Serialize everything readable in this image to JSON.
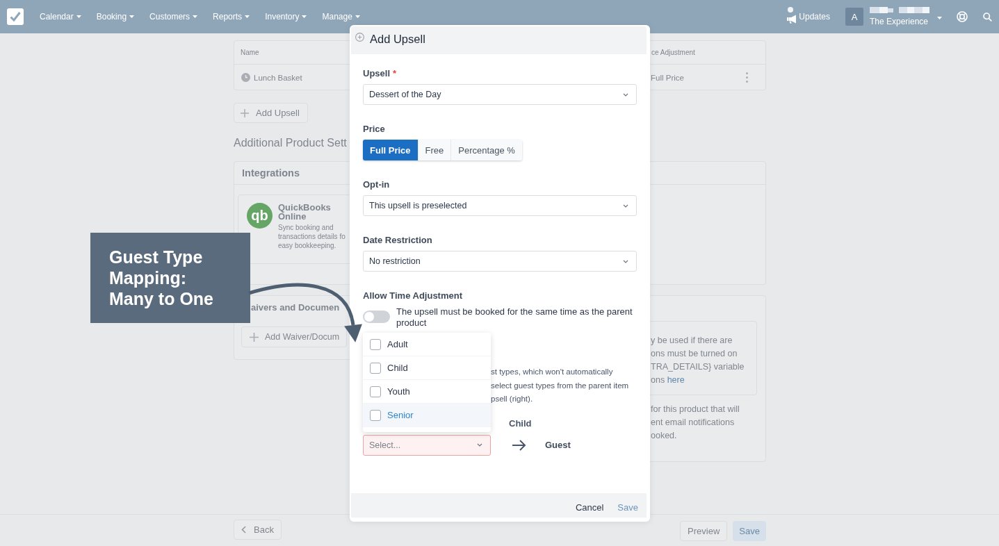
{
  "nav": {
    "items": [
      {
        "label": "Calendar"
      },
      {
        "label": "Booking"
      },
      {
        "label": "Customers"
      },
      {
        "label": "Reports"
      },
      {
        "label": "Inventory"
      },
      {
        "label": "Manage"
      }
    ],
    "updates": "Updates",
    "account": {
      "initial": "A",
      "name": "The Experience"
    }
  },
  "upsells_table": {
    "columns": [
      "Name",
      "ce Adjustment"
    ],
    "rows": [
      {
        "cells": [
          "Lunch Basket",
          "Full Price"
        ]
      }
    ]
  },
  "add_upsell_button": "Add Upsell",
  "section_title": "Additional Product Sett",
  "integrations": {
    "title": "Integrations",
    "items": [
      {
        "logo": "qb",
        "name": "QuickBooks Online",
        "description": [
          "Sync booking and",
          "transactions details fo",
          "easy bookkeeping."
        ]
      }
    ]
  },
  "waivers": {
    "title": "aivers and Documen",
    "add_button": "Add Waiver/Docum"
  },
  "right_panel": {
    "info": [
      "y be used if there are",
      "ons must be turned on",
      "TRA_DETAILS} variable",
      "ons"
    ],
    "info_link": "here",
    "description": [
      "for this product that will",
      "ent email notifications",
      "ooked."
    ]
  },
  "bottom_bar": {
    "back": "Back",
    "preview": "Preview",
    "save": {
      "label": "Save",
      "disabled": true
    }
  },
  "modal": {
    "title": "Add Upsell",
    "fields": [
      {
        "kind": "select",
        "label": "Upsell",
        "required_mark": "*",
        "value": "Dessert of the Day"
      },
      {
        "kind": "segmented",
        "label": "Price",
        "options": [
          {
            "label": "Full Price",
            "selected": true
          },
          {
            "label": "Free",
            "selected": false
          },
          {
            "label": "Percentage %",
            "selected": false
          }
        ]
      },
      {
        "kind": "select",
        "label": "Opt-in",
        "value": "This upsell is preselected"
      },
      {
        "kind": "select",
        "label": "Date Restriction",
        "value": "No restriction"
      },
      {
        "kind": "toggle",
        "label": "Allow Time Adjustment",
        "on": false,
        "text": "The upsell must be booked for the same time as the parent product"
      }
    ],
    "guest_mapping": {
      "description": [
        "st types, which won't automatically",
        "select guest types from the parent item",
        "psell (right)."
      ],
      "parent_type": "Child",
      "rows": [
        {
          "placeholder": "Select...",
          "invalid": true,
          "expanded": true,
          "target": "Guest",
          "options": [
            {
              "label": "Adult",
              "checked": false,
              "highlighted": false
            },
            {
              "label": "Child",
              "checked": false,
              "highlighted": false
            },
            {
              "label": "Youth",
              "checked": false,
              "highlighted": false
            },
            {
              "label": "Senior",
              "checked": false,
              "highlighted": true
            }
          ]
        }
      ]
    },
    "buttons": {
      "cancel": "Cancel",
      "save": {
        "label": "Save",
        "disabled": true
      }
    }
  },
  "callout": {
    "lines": [
      "Guest Type",
      "Mapping:",
      "Many to One"
    ]
  }
}
